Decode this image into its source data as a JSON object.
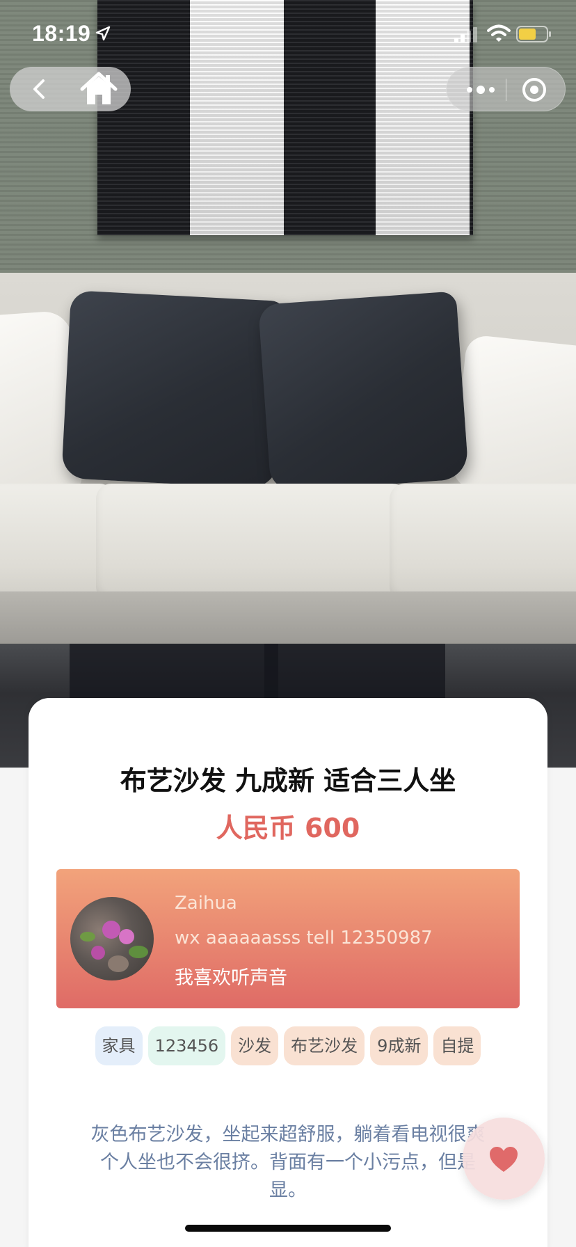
{
  "status_bar": {
    "time": "18:19",
    "icons": [
      "location-arrow-icon",
      "signal-icon",
      "wifi-icon",
      "battery-icon"
    ],
    "battery_color": "#f2cf45"
  },
  "nav": {
    "left_icons": [
      "back-icon",
      "home-icon"
    ],
    "right_icons": [
      "more-dots-icon",
      "close-target-icon"
    ]
  },
  "product": {
    "title": "布艺沙发 九成新 适合三人坐",
    "price": "人民币 600",
    "price_color": "#e0675f"
  },
  "seller": {
    "name": "Zaihua",
    "contact": "wx aaaaaasss tell 12350987",
    "bio": "我喜欢听声音",
    "gradient": [
      "#f2a37b",
      "#df6b66"
    ]
  },
  "tags": [
    {
      "label": "家具",
      "color": "#e4eefa"
    },
    {
      "label": "123456",
      "color": "#e3f6ef"
    },
    {
      "label": "沙发",
      "color": "#f9e1d2"
    },
    {
      "label": "布艺沙发",
      "color": "#f9e1d2"
    },
    {
      "label": "9成新",
      "color": "#f9e1d2"
    },
    {
      "label": "自提",
      "color": "#f9e1d2"
    }
  ],
  "description": {
    "line1": "灰色布艺沙发，坐起来超舒服，躺着看电视很爽",
    "line2": "个人坐也不会很挤。背面有一个小污点，但是",
    "line3": "显。"
  },
  "like_button": {
    "icon": "heart-icon",
    "color": "#e06a6a"
  }
}
